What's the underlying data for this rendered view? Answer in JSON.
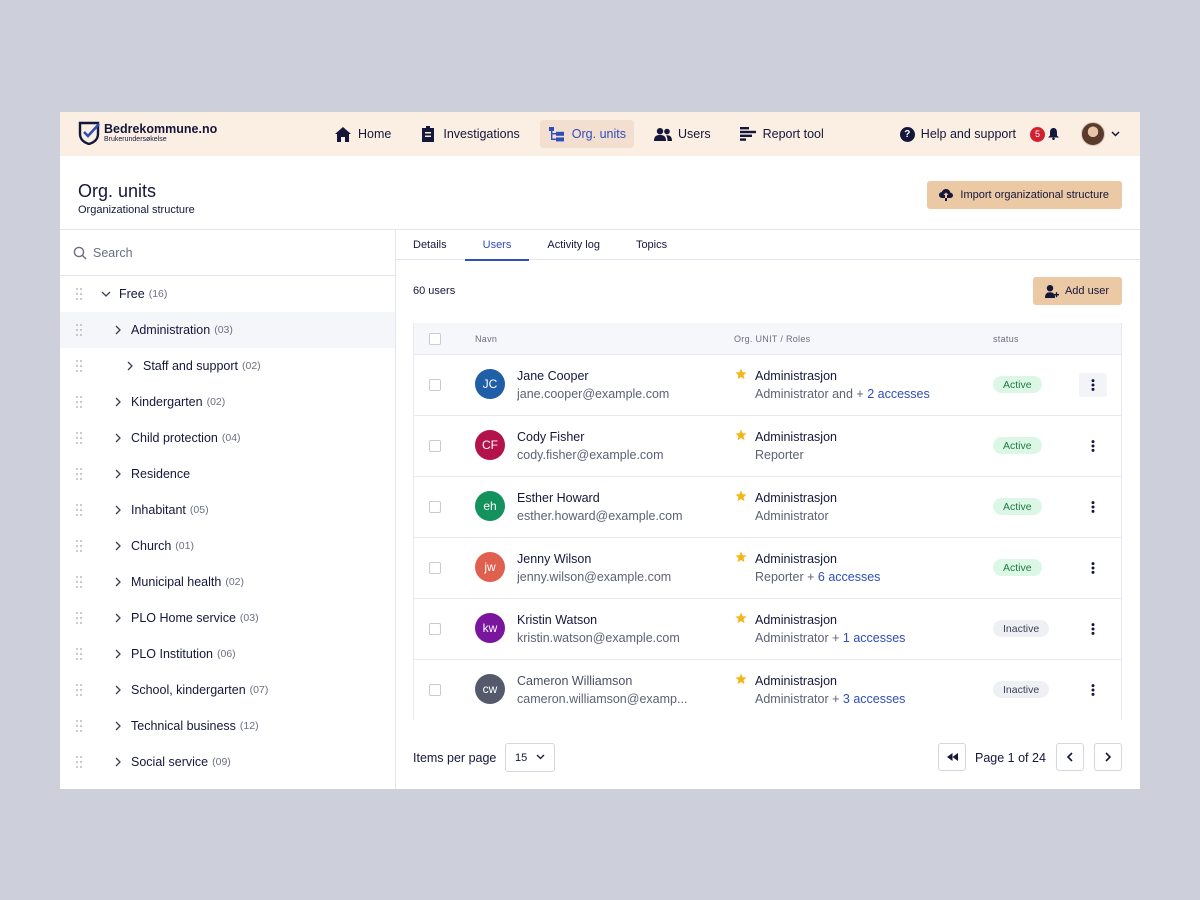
{
  "brand": {
    "name": "Bedrekommune.no",
    "tagline": "Brukerundersøkelse"
  },
  "nav": [
    {
      "label": "Home",
      "icon": "home-icon"
    },
    {
      "label": "Investigations",
      "icon": "clipboard-icon"
    },
    {
      "label": "Org. units",
      "icon": "org-tree-icon",
      "active": true
    },
    {
      "label": "Users",
      "icon": "users-icon"
    },
    {
      "label": "Report tool",
      "icon": "report-icon"
    }
  ],
  "toolbar": {
    "help_label": "Help and support",
    "notification_count": "5"
  },
  "page": {
    "title": "Org. units",
    "subtitle": "Organizational structure",
    "import_label": "Import organizational structure"
  },
  "search": {
    "placeholder": "Search"
  },
  "tree": [
    {
      "label": "Free",
      "count": "(16)",
      "expanded": true
    },
    {
      "label": "Administration",
      "count": "(03)"
    },
    {
      "label": "Staff and support",
      "count": "(02)"
    },
    {
      "label": "Kindergarten",
      "count": "(02)"
    },
    {
      "label": "Child protection",
      "count": "(04)"
    },
    {
      "label": "Residence",
      "count": ""
    },
    {
      "label": "Inhabitant",
      "count": "(05)"
    },
    {
      "label": "Church",
      "count": "(01)"
    },
    {
      "label": "Municipal health",
      "count": "(02)"
    },
    {
      "label": "PLO Home service",
      "count": "(03)"
    },
    {
      "label": "PLO Institution",
      "count": "(06)"
    },
    {
      "label": "School, kindergarten",
      "count": "(07)"
    },
    {
      "label": "Technical business",
      "count": "(12)"
    },
    {
      "label": "Social service",
      "count": "(09)"
    }
  ],
  "tabs": [
    "Details",
    "Users",
    "Activity log",
    "Topics"
  ],
  "users_count": "60 users",
  "add_user_label": "Add user",
  "table": {
    "headers": {
      "name": "Navn",
      "org": "Org. UNIT / Roles",
      "status": "status"
    },
    "rows": [
      {
        "initials": "JC",
        "color": "#1f5fa8",
        "name": "Jane Cooper",
        "email": "jane.cooper@example.com",
        "org": "Administrasjon",
        "role": "Administrator and + ",
        "extra": "2 accesses",
        "status": "Active"
      },
      {
        "initials": "CF",
        "color": "#b3134a",
        "name": "Cody Fisher",
        "email": "cody.fisher@example.com",
        "org": "Administrasjon",
        "role": "Reporter",
        "extra": "",
        "status": "Active"
      },
      {
        "initials": "eh",
        "color": "#14925e",
        "name": "Esther Howard",
        "email": "esther.howard@example.com",
        "org": "Administrasjon",
        "role": "Administrator",
        "extra": "",
        "status": "Active"
      },
      {
        "initials": "jw",
        "color": "#e0604f",
        "name": "Jenny Wilson",
        "email": "jenny.wilson@example.com",
        "org": "Administrasjon",
        "role": "Reporter + ",
        "extra": "6 accesses",
        "status": "Active"
      },
      {
        "initials": "kw",
        "color": "#7a159e",
        "name": "Kristin Watson",
        "email": "kristin.watson@example.com",
        "org": "Administrasjon",
        "role": "Administrator + ",
        "extra": "1 accesses",
        "status": "Inactive"
      },
      {
        "initials": "cw",
        "color": "#545a6b",
        "name": "Cameron Williamson",
        "email": "cameron.williamson@examp...",
        "org": "Administrasjon",
        "role": "Administrator + ",
        "extra": "3 accesses",
        "status": "Inactive"
      }
    ]
  },
  "pagination": {
    "items_per_page_label": "Items per page",
    "items_per_page_value": "15",
    "page_text": "Page 1 of 24"
  },
  "colors": {
    "topbar": "#fbeee3",
    "accent": "#2f4dbb",
    "button": "#ebc9a5",
    "star": "#f2b619"
  }
}
